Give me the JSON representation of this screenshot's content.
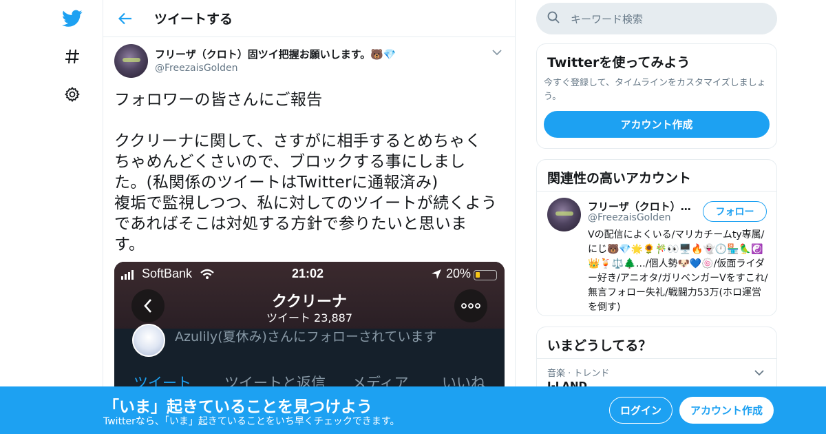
{
  "colors": {
    "brand": "#1da1f2",
    "text": "#14171a",
    "muted": "#657786",
    "border": "#e6ecf0"
  },
  "nav": {
    "icons": [
      "twitter-logo-icon",
      "hashtag-icon",
      "gear-icon"
    ]
  },
  "header": {
    "title": "ツイートする"
  },
  "tweet": {
    "user_name": "フリーザ（クロト）固ツイ把握お願いします。🐻💎",
    "user_handle": "@FreezaisGolden",
    "text": "フォロワーの皆さんにご報告\n\nククリーナに関して、さすがに相手するとめちゃく\nちゃめんどくさいので、ブロックする事にしまし\nた。(私関係のツイートはTwitterに通報済み)\n複垢で監視しつつ、私に対してのツイートが続くよう\nであればそこは対処する方針で参りたいと思いま\nす。",
    "media": {
      "carrier": "SoftBank",
      "time": "21:02",
      "battery": "20%",
      "profile_name": "ククリーナ",
      "tweet_count": "ツイート 23,887",
      "followed_by": "Azulily(夏休み)さんにフォローされています",
      "tabs": [
        "ツイート",
        "ツイートと返信",
        "メディア",
        "いいね"
      ]
    }
  },
  "sidebar": {
    "search_placeholder": "キーワード検索",
    "try": {
      "title": "Twitterを使ってみよう",
      "desc": "今すぐ登録して、タイムラインをカスタマイズしましょう。",
      "button": "アカウント作成"
    },
    "related": {
      "title": "関連性の高いアカウント",
      "name": "フリーザ（クロト）固ツイ把握お願いします。🐻💎",
      "handle": "@FreezaisGolden",
      "follow": "フォロー",
      "bio": "Vの配信によくいる/マリカチームty専属/にじ🐻💎🌟🌻🎋👀🖥️🔥👻🕛🏪🦜☯️👑🍹⚖️🌲…/個人勢🐶💙🍥/仮面ライダー好き/アニオタ/ガリベンガーVをすこれ/無言フォロー失礼/戦闘力53万(ホロ運営を倒す)"
    },
    "now": {
      "title": "いまどうしてる？",
      "trend_category": "音楽 · トレンド",
      "trend_name": "I-LAND"
    }
  },
  "bottom_bar": {
    "title": "「いま」起きていることを見つけよう",
    "subtitle": "Twitterなら、「いま」起きていることをいち早くチェックできます。",
    "login": "ログイン",
    "signup": "アカウント作成"
  }
}
